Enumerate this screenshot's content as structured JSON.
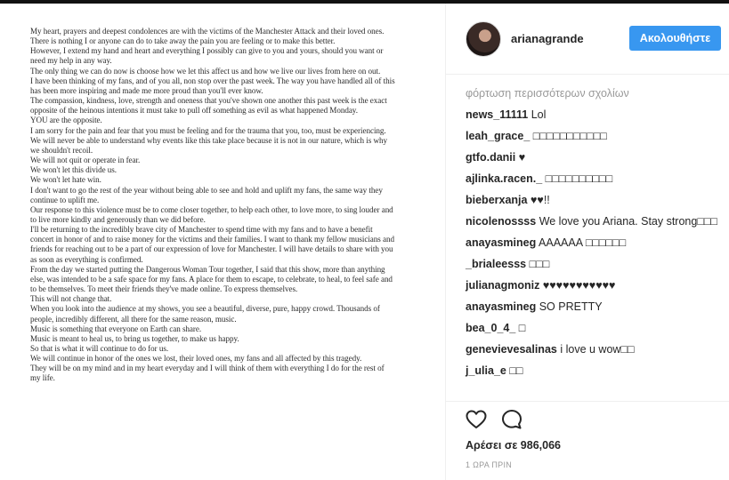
{
  "post": {
    "letter_paragraphs": [
      "My heart, prayers and deepest condolences are with the victims of the Manchester Attack and their loved ones.",
      "There is nothing I or anyone can do to take away the pain you are feeling or to make this better.",
      "However, I extend my hand and heart and everything I possibly can give to you and yours, should you want or need my help in any way.",
      "The only thing we can do now is choose how we let this affect us and how we live our lives from here on out.",
      "I have been thinking of my fans, and of you all, non stop over the past week. The way you have handled all of this has been more inspiring and made me more proud than you'll ever know.",
      "The compassion, kindness, love, strength and oneness that you've shown one another this past week is the exact opposite of the heinous intentions it must take to pull off something as evil as what happened Monday.",
      "YOU are the opposite.",
      "I am sorry for the pain and fear that you must be feeling and for the trauma that you, too, must be experiencing.",
      "We will never be able to understand why events like this take place because it is not in our nature, which is why we shouldn't recoil.",
      "We will not quit or operate in fear.",
      "We won't let this divide us.",
      "We won't let hate win.",
      "I don't want to go the rest of the year without being able to see and hold and uplift my fans, the same way they continue to uplift me.",
      "Our response to this violence must be to come closer together, to help each other, to love more, to sing louder and to live more kindly and generously than we did before.",
      "I'll be returning to the incredibly brave city of Manchester to spend time with my fans and to have a benefit concert in honor of and to raise money for the victims and their families. I want to thank my fellow musicians and friends for reaching out to be a part of our expression of love for Manchester. I will have details to share with you as soon as everything is confirmed.",
      "From the day we started putting the Dangerous Woman Tour together, I said that this show, more than anything else, was intended to be a safe space for my fans. A place for them to escape, to celebrate, to heal, to feel safe and to be themselves. To meet their friends they've made online. To express themselves.",
      "This will not change that.",
      "When you look into the audience at my shows, you see a beautiful, diverse, pure, happy crowd. Thousands of people, incredibly different, all there for the same reason, music.",
      "Music is something that everyone on Earth can share.",
      "Music is meant to heal us, to bring us together, to make us happy.",
      "So that is what it will continue to do for us.",
      "We will continue in honor of the ones we lost, their loved ones, my fans and all affected by this tragedy.",
      "They will be on my mind and in my heart everyday and I will think of them with everything I do for the rest of my life."
    ]
  },
  "header": {
    "username": "arianagrande",
    "follow_label": "Ακολουθήστε"
  },
  "load_more_label": "φόρτωση περισσότερων σχολίων",
  "comments": [
    {
      "user": "news_11111",
      "text": "Lol"
    },
    {
      "user": "leah_grace_",
      "text": "□□□□□□□□□□□"
    },
    {
      "user": "gtfo.danii",
      "text": "♥"
    },
    {
      "user": "ajlinka.racen._",
      "text": "□□□□□□□□□□"
    },
    {
      "user": "bieberxanja",
      "text": "♥♥!!"
    },
    {
      "user": "nicolenossss",
      "text": "We love you Ariana. Stay strong□□□"
    },
    {
      "user": "anayasmineg",
      "text": "AAAAAA □□□□□□"
    },
    {
      "user": "_brialeesss",
      "text": "□□□"
    },
    {
      "user": "julianagmoniz",
      "text": "♥♥♥♥♥♥♥♥♥♥♥"
    },
    {
      "user": "anayasmineg",
      "text": "SO PRETTY"
    },
    {
      "user": "bea_0_4_",
      "text": "□"
    },
    {
      "user": "genevievesalinas",
      "text": "i love u wow□□"
    },
    {
      "user": "j_ulia_e",
      "text": "□□"
    }
  ],
  "likes_label": "Αρέσει σε 986,066",
  "timestamp": "1 ΩΡΑ ΠΡΙΝ",
  "icons": {
    "like": "heart-icon",
    "comment": "speech-bubble-icon"
  },
  "colors": {
    "follow_button": "#3897f0",
    "muted_text": "#999999",
    "text": "#262626"
  }
}
